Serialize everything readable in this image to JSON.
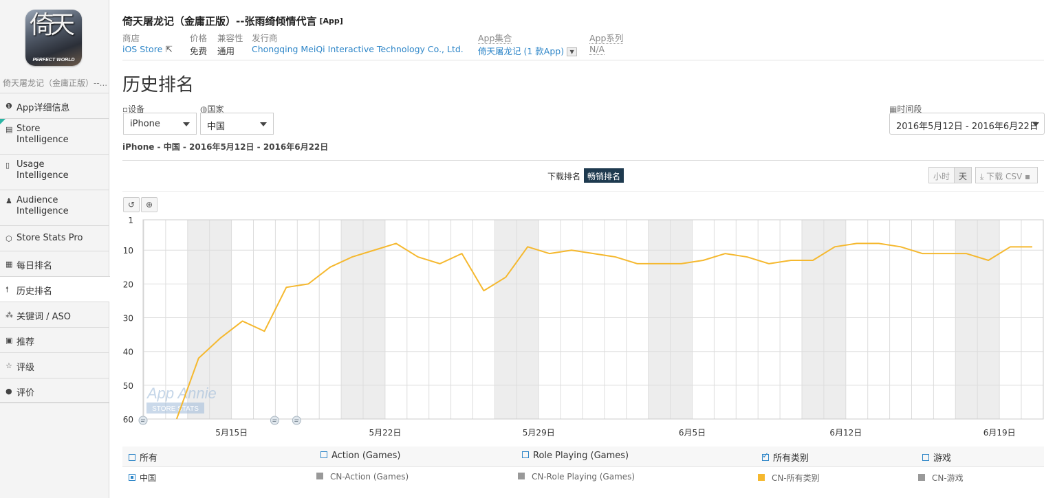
{
  "app": {
    "icon_brand": "PERFECT WORLD",
    "icon_glyph": "倚天",
    "sidebar_name": "倚天屠龙记（金庸正版）--...",
    "title": "倚天屠龙记（金庸正版）--张雨绮倾情代言",
    "title_tag": "[App]"
  },
  "meta": {
    "store_label": "商店",
    "store_value": "iOS Store",
    "price_label": "价格",
    "price_value": "免费",
    "compat_label": "兼容性",
    "compat_value": "通用",
    "publisher_label": "发行商",
    "publisher_value": "Chongqing MeiQi Interactive Technology Co., Ltd.",
    "collection_label": "App集合",
    "collection_value": "倚天屠龙记 (1 款App)",
    "series_label": "App系列",
    "series_value": "N/A"
  },
  "sidebar": {
    "items": [
      {
        "icon": "info-icon",
        "glyph": "❶",
        "label": "App详细信息"
      },
      {
        "icon": "store-icon",
        "glyph": "▤",
        "label": "Store",
        "label2": "Intelligence"
      },
      {
        "icon": "usage-icon",
        "glyph": "▯",
        "label": "Usage",
        "label2": "Intelligence"
      },
      {
        "icon": "audience-icon",
        "glyph": "♟",
        "label": "Audience",
        "label2": "Intelligence"
      },
      {
        "icon": "storestats-icon",
        "glyph": "⬡",
        "label": "Store Stats Pro"
      },
      {
        "icon": "calendar-icon",
        "glyph": "▦",
        "label": "每日排名"
      },
      {
        "icon": "arrow-up-icon",
        "glyph": "🠕",
        "label": "历史排名"
      },
      {
        "icon": "keyword-icon",
        "glyph": "⁂",
        "label": "关键词 / ASO"
      },
      {
        "icon": "featured-icon",
        "glyph": "▣",
        "label": "推荐"
      },
      {
        "icon": "star-icon",
        "glyph": "☆",
        "label": "评级"
      },
      {
        "icon": "comment-icon",
        "glyph": "●",
        "label": "评价"
      }
    ]
  },
  "page": {
    "title": "历史排名",
    "device_label": "设备",
    "device_value": "iPhone",
    "country_label": "国家",
    "country_value": "中国",
    "period_label": "时间段",
    "period_value": "2016年5月12日 - 2016年6月22日",
    "subtitle": "iPhone - 中国 - 2016年5月12日 - 2016年6月22日"
  },
  "toolbar": {
    "tab_downloads": "下载排名",
    "tab_grossing": "畅销排名",
    "hour": "小时",
    "day": "天",
    "csv": "下载 CSV"
  },
  "watermark": {
    "line1": "App Annie",
    "line2": "STORE STATS"
  },
  "legend": {
    "row1": [
      {
        "label": "所有",
        "checked": false
      },
      {
        "label": "Action (Games)",
        "checked": false
      },
      {
        "label": "Role Playing (Games)",
        "checked": false
      },
      {
        "label": "所有类别",
        "checked": true
      },
      {
        "label": "游戏",
        "checked": false
      }
    ],
    "row2": [
      {
        "label": "中国"
      },
      {
        "label": "CN-Action (Games)",
        "color": "#999999"
      },
      {
        "label": "CN-Role Playing (Games)",
        "color": "#999999"
      },
      {
        "label": "CN-所有类别",
        "color": "#f5b82e"
      },
      {
        "label": "CN-游戏",
        "color": "#999999"
      }
    ]
  },
  "chart_data": {
    "type": "line",
    "title": "",
    "xlabel": "",
    "ylabel": "",
    "y_inverted": true,
    "ylim": [
      1,
      60
    ],
    "yticks": [
      1,
      10,
      20,
      30,
      40,
      50,
      60
    ],
    "x_start": "2016-05-12",
    "xtick_labels": [
      {
        "day": 3,
        "label": "5月15日"
      },
      {
        "day": 10,
        "label": "5月22日"
      },
      {
        "day": 17,
        "label": "5月29日"
      },
      {
        "day": 24,
        "label": "6月5日"
      },
      {
        "day": 31,
        "label": "6月12日"
      },
      {
        "day": 38,
        "label": "6月19日"
      }
    ],
    "shaded_weekend_days": [
      2,
      3,
      9,
      10,
      16,
      17,
      23,
      24,
      30,
      31,
      37,
      38
    ],
    "series": [
      {
        "name": "CN-所有类别",
        "color": "#f5b82e",
        "x": [
          "2016-05-13",
          "2016-05-14",
          "2016-05-15",
          "2016-05-16",
          "2016-05-17",
          "2016-05-18",
          "2016-05-19",
          "2016-05-20",
          "2016-05-21",
          "2016-05-22",
          "2016-05-23",
          "2016-05-24",
          "2016-05-25",
          "2016-05-26",
          "2016-05-27",
          "2016-05-28",
          "2016-05-29",
          "2016-05-30",
          "2016-05-31",
          "2016-06-01",
          "2016-06-02",
          "2016-06-03",
          "2016-06-04",
          "2016-06-05",
          "2016-06-06",
          "2016-06-07",
          "2016-06-08",
          "2016-06-09",
          "2016-06-10",
          "2016-06-11",
          "2016-06-12",
          "2016-06-13",
          "2016-06-14",
          "2016-06-15",
          "2016-06-16",
          "2016-06-17",
          "2016-06-18",
          "2016-06-19",
          "2016-06-20",
          "2016-06-21"
        ],
        "values": [
          60,
          42,
          36,
          31,
          34,
          21,
          20,
          15,
          12,
          10,
          8,
          12,
          14,
          11,
          22,
          18,
          9,
          11,
          10,
          11,
          12,
          14,
          14,
          14,
          13,
          11,
          12,
          14,
          13,
          13,
          9,
          8,
          8,
          9,
          11,
          11,
          11,
          13,
          9,
          9
        ]
      }
    ],
    "annotation_days": [
      0,
      6,
      7
    ]
  }
}
